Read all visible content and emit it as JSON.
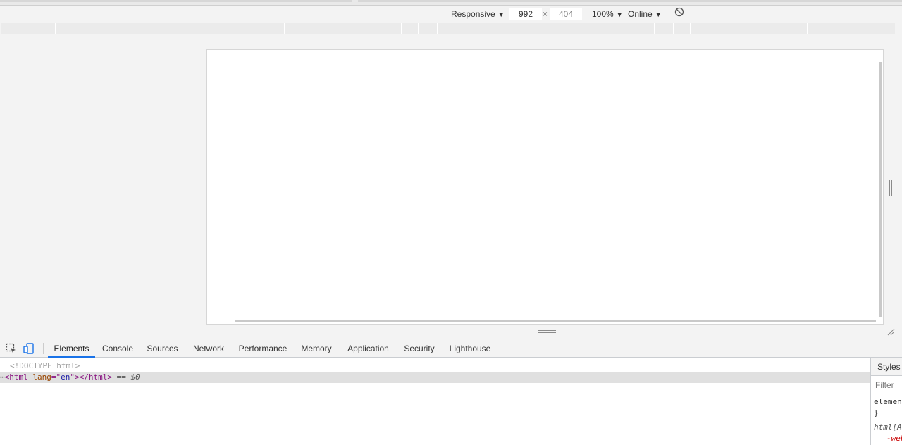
{
  "device_toolbar": {
    "device": "Responsive",
    "width": "992",
    "times": "×",
    "height": "404",
    "zoom": "100%",
    "throttle": "Online",
    "caret": "▼"
  },
  "devtools": {
    "tabs": [
      {
        "label": "Elements",
        "active": true
      },
      {
        "label": "Console"
      },
      {
        "label": "Sources"
      },
      {
        "label": "Network"
      },
      {
        "label": "Performance"
      },
      {
        "label": "Memory"
      },
      {
        "label": "Application"
      },
      {
        "label": "Security"
      },
      {
        "label": "Lighthouse"
      }
    ],
    "elements": {
      "doctype": "<!DOCTYPE html>",
      "line2_dots": "⋯",
      "line2_open": "<html",
      "line2_attr_name": "lang",
      "line2_eq": "=\"",
      "line2_attr_val": "en",
      "line2_close": "\"></html>",
      "line2_note": "== $0"
    },
    "styles": {
      "tab_label": "Styles",
      "filter_placeholder": "Filter",
      "line1": "element.style {",
      "line2": "}",
      "line3": "html[Attributes Style] {",
      "line4": "-webkit-locale: \"en\";"
    }
  }
}
